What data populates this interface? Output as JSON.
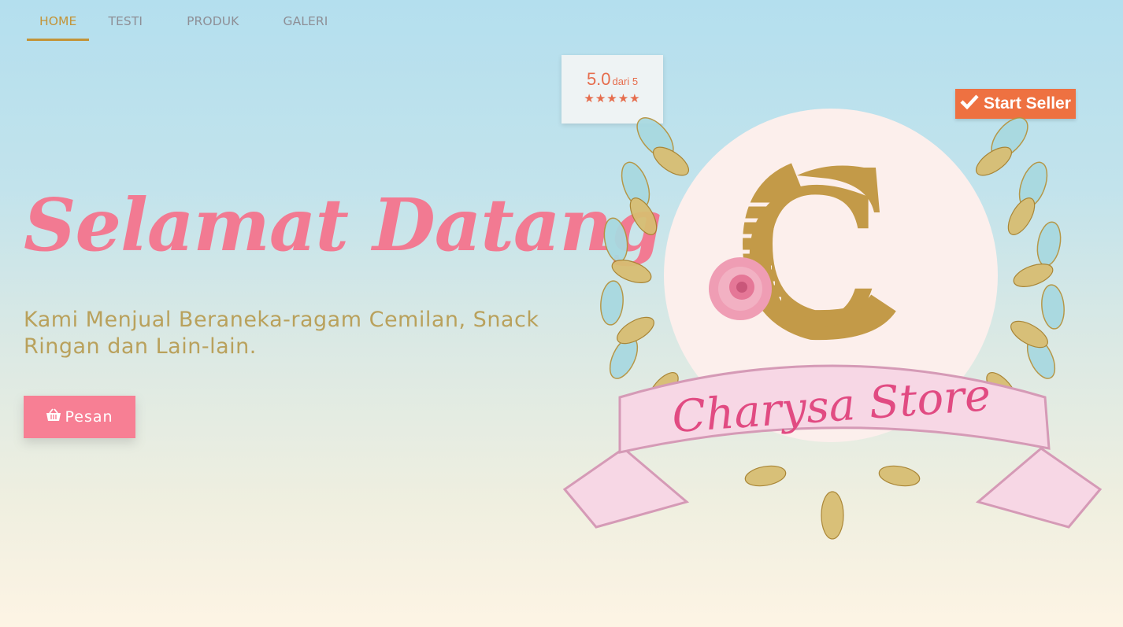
{
  "nav": {
    "items": [
      {
        "label": "HOME",
        "active": true
      },
      {
        "label": "TESTI",
        "active": false
      },
      {
        "label": "PRODUK",
        "active": false
      },
      {
        "label": "GALERI",
        "active": false
      }
    ]
  },
  "hero": {
    "title": "Selamat Datang",
    "subtitle": "Kami Menjual Beraneka-ragam Cemilan, Snack Ringan dan Lain-lain.",
    "order_button": {
      "label": "Pesan",
      "icon": "basket-icon"
    }
  },
  "rating": {
    "score": "5.0",
    "out_of": "dari 5",
    "stars": "★★★★★",
    "value": 5
  },
  "seller_badge": {
    "label": "Start Seller",
    "icon": "check-icon"
  },
  "logo": {
    "monogram": "C",
    "brand_text": "Charysa Store"
  },
  "colors": {
    "title_pink": "#f27a92",
    "gold": "#c39438",
    "button_pink": "#f77f94",
    "badge_orange": "#ee7141"
  }
}
